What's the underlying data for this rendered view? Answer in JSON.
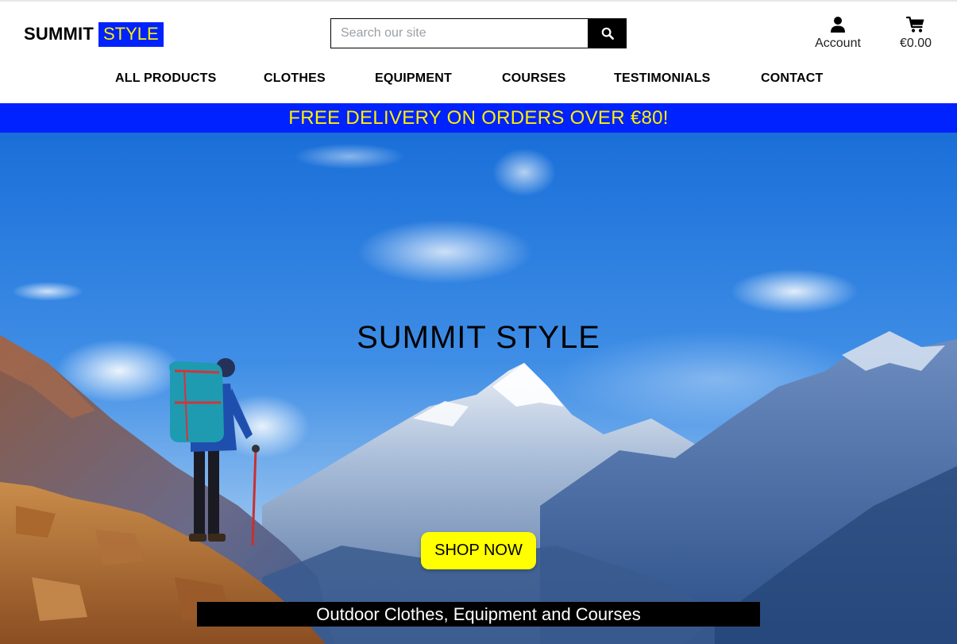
{
  "header": {
    "logo_main": "SUMMIT",
    "logo_accent": "STYLE",
    "search_placeholder": "Search our site",
    "account_label": "Account",
    "cart_total": "€0.00"
  },
  "nav": {
    "items": [
      "ALL PRODUCTS",
      "CLOTHES",
      "EQUIPMENT",
      "COURSES",
      "TESTIMONIALS",
      "CONTACT"
    ]
  },
  "promo": {
    "text": "FREE DELIVERY ON ORDERS OVER €80!"
  },
  "hero": {
    "title": "SUMMIT STYLE",
    "cta_label": "SHOP NOW",
    "tagline": "Outdoor Clothes, Equipment and Courses"
  },
  "icons": {
    "search": "search-icon",
    "account": "user-icon",
    "cart": "shopping-cart-icon"
  },
  "colors": {
    "brand_blue": "#0022ff",
    "brand_yellow": "#fff000",
    "cta_yellow": "#ffff00"
  }
}
